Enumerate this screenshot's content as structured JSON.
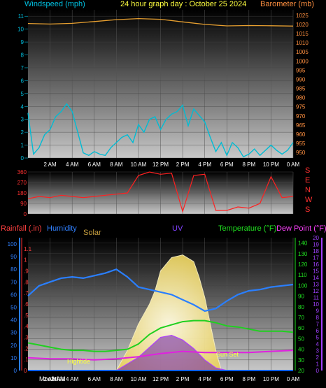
{
  "header": {
    "left": "Windspeed (mph)",
    "center": "24 hour graph day : October 25 2024",
    "right": "Barometer (mb)"
  },
  "panel3_labels": {
    "rainfall": "Rainfall (.in)",
    "humidity": "Humidity",
    "solar": "Solar",
    "uv": "UV",
    "temperature": "Temperature (°F)",
    "dewpoint": "Dew Point (°F)"
  },
  "annotations": {
    "hightide": "Hightide",
    "sunset": "Sun Set",
    "moonrise": "Moonrise",
    "time_overlap": "2 AM"
  },
  "colors": {
    "windspeed": "#00bcd4",
    "barometer": "#e8a030",
    "direction": "#ff2020",
    "humidity": "#2a7fff",
    "temperature": "#20d020",
    "dewpoint": "#e020e0",
    "uv": "#6a1aa8",
    "solar": "#f0e8a0",
    "rainfall": "#0060ff",
    "header_left": "#00c0e0",
    "header_center": "#ffff40",
    "header_right": "#ff9040"
  },
  "chart_data": [
    {
      "type": "line",
      "name": "windspeed",
      "x_ticks": [
        "2 AM",
        "4 AM",
        "6 AM",
        "8 AM",
        "10 AM",
        "12 PM",
        "2 PM",
        "4 PM",
        "6 PM",
        "8 PM",
        "10 PM",
        "0 AM"
      ],
      "left_axis": {
        "label": "Windspeed (mph)",
        "ylim": [
          0,
          11.5
        ],
        "ticks": [
          0,
          1,
          2,
          3,
          4,
          5,
          6,
          7,
          8,
          9,
          10,
          11
        ]
      },
      "right_axis": {
        "label": "Barometer (mb)",
        "ylim": [
          947,
          1028
        ],
        "ticks": [
          950,
          955,
          960,
          965,
          970,
          975,
          980,
          985,
          990,
          995,
          1000,
          1005,
          1010,
          1015,
          1020,
          1025
        ]
      },
      "series": [
        {
          "name": "Windspeed",
          "x_hours": [
            0,
            0.5,
            1,
            1.5,
            2,
            2.5,
            3,
            3.5,
            4,
            4.5,
            5,
            5.5,
            6,
            6.5,
            7,
            7.5,
            8,
            8.5,
            9,
            9.5,
            10,
            10.5,
            11,
            11.5,
            12,
            12.5,
            13,
            13.5,
            14,
            14.5,
            15,
            15.5,
            16,
            16.5,
            17,
            17.5,
            18,
            18.5,
            19,
            19.5,
            20,
            20.5,
            21,
            21.5,
            22,
            22.5,
            23,
            23.5,
            24
          ],
          "values": [
            3.5,
            0.3,
            0.8,
            1.8,
            2.2,
            3.2,
            3.6,
            4.2,
            3.6,
            2.0,
            0.4,
            0.2,
            0.5,
            0.3,
            0.2,
            0.8,
            1.2,
            1.6,
            1.8,
            1.2,
            2.6,
            2.0,
            3.0,
            3.2,
            2.2,
            3.0,
            3.4,
            3.6,
            4.1,
            2.5,
            3.8,
            3.3,
            2.8,
            1.6,
            0.5,
            1.2,
            0.2,
            1.2,
            0.8,
            0.1,
            0.3,
            0.7,
            0.2,
            0.6,
            1.0,
            0.6,
            0.3,
            0.6,
            1.2
          ]
        },
        {
          "name": "Barometer",
          "x_hours": [
            0,
            2,
            4,
            6,
            8,
            10,
            12,
            14,
            16,
            18,
            20,
            22,
            24
          ],
          "values": [
            1020.5,
            1020.2,
            1020.6,
            1021.6,
            1022.6,
            1023.2,
            1022.8,
            1021.4,
            1020.0,
            1019.2,
            1019.4,
            1019.3,
            1019.1
          ]
        }
      ]
    },
    {
      "type": "line",
      "name": "wind_direction",
      "left_axis": {
        "ylim": [
          0,
          360
        ],
        "ticks": [
          0,
          90,
          180,
          270,
          360
        ]
      },
      "right_labels": [
        "S",
        "E",
        "N",
        "W",
        "S"
      ],
      "series": [
        {
          "name": "Wind direction",
          "x_hours": [
            0,
            1,
            2,
            3,
            4,
            5,
            6,
            7,
            8,
            9,
            10,
            11,
            12,
            13,
            14,
            15,
            16,
            17,
            18,
            19,
            20,
            21,
            22,
            23,
            24
          ],
          "values": [
            130,
            150,
            140,
            160,
            150,
            140,
            150,
            160,
            170,
            180,
            330,
            360,
            340,
            350,
            20,
            330,
            340,
            30,
            30,
            60,
            50,
            90,
            320,
            140,
            150
          ]
        }
      ]
    },
    {
      "type": "line",
      "name": "weather_multi",
      "x_ticks": [
        "2 AM",
        "4 AM",
        "6 AM",
        "8 AM",
        "10 AM",
        "12 PM",
        "2 PM",
        "4 PM",
        "6 PM",
        "8 PM",
        "10 PM",
        "0 AM"
      ],
      "rain_axis": {
        "label": "Rainfall (.in)",
        "ylim": [
          0,
          1.2
        ],
        "ticks": [
          0,
          0.1,
          0.2,
          0.3,
          0.4,
          0.5,
          0.6,
          0.7,
          0.8,
          0.9,
          1.0,
          1.1
        ]
      },
      "humidity_axis": {
        "label": "Humidity",
        "ylim": [
          0,
          105
        ],
        "ticks": [
          0,
          10,
          20,
          30,
          40,
          50,
          60,
          70,
          80,
          90,
          100
        ]
      },
      "temperature_axis": {
        "label": "Temperature (°F)",
        "ylim": [
          20,
          145
        ],
        "ticks": [
          20,
          30,
          40,
          50,
          60,
          70,
          80,
          90,
          100,
          110,
          120,
          130,
          140
        ]
      },
      "uv_axis": {
        "label": "UV",
        "ylim": [
          0,
          20
        ],
        "ticks": [
          0,
          1,
          2,
          3,
          4,
          5,
          6,
          7,
          8,
          9,
          10,
          11,
          12,
          13,
          14,
          15,
          16,
          17,
          18,
          19,
          20
        ]
      },
      "series": [
        {
          "name": "Humidity",
          "x_hours": [
            0,
            1,
            2,
            3,
            4,
            5,
            6,
            7,
            8,
            9,
            10,
            11,
            12,
            13,
            14,
            15,
            16,
            17,
            18,
            19,
            20,
            21,
            22,
            23,
            24
          ],
          "values": [
            59,
            67,
            70,
            73,
            74,
            73,
            75,
            77,
            80,
            74,
            66,
            64,
            62,
            60,
            56,
            52,
            47,
            49,
            55,
            60,
            63,
            64,
            66,
            67,
            68
          ]
        },
        {
          "name": "Temperature",
          "x_hours": [
            0,
            1,
            2,
            3,
            4,
            5,
            6,
            7,
            8,
            9,
            10,
            11,
            12,
            13,
            14,
            15,
            16,
            17,
            18,
            19,
            20,
            21,
            22,
            23,
            24
          ],
          "values": [
            46,
            44,
            42,
            40,
            39,
            39,
            38,
            38,
            39,
            40,
            45,
            54,
            60,
            63,
            66,
            67,
            67,
            65,
            62,
            61,
            59,
            57,
            57,
            57,
            56
          ]
        },
        {
          "name": "Dew Point",
          "x_hours": [
            0,
            2,
            4,
            6,
            8,
            10,
            12,
            14,
            16,
            18,
            20,
            22,
            24
          ],
          "values": [
            32,
            31,
            31,
            30,
            31,
            33,
            36,
            38,
            37,
            37,
            37,
            38,
            39
          ]
        },
        {
          "name": "UV",
          "x_hours": [
            0,
            7,
            8,
            9,
            10,
            11,
            12,
            13,
            14,
            15,
            16,
            17,
            18,
            24
          ],
          "values": [
            0,
            0,
            0,
            1,
            2,
            3.5,
            5,
            5.3,
            4.6,
            3.3,
            1.6,
            0.4,
            0,
            0
          ]
        },
        {
          "name": "Solar",
          "x_hours": [
            8,
            9,
            10,
            11,
            11.5,
            12,
            13,
            14,
            15,
            15.5,
            16,
            16.5,
            17,
            17.5
          ],
          "values": [
            0,
            0.15,
            0.35,
            0.5,
            0.6,
            0.75,
            0.85,
            0.87,
            0.82,
            0.7,
            0.55,
            0.35,
            0.15,
            0
          ]
        },
        {
          "name": "Rainfall",
          "x_hours": [
            0,
            24
          ],
          "values": [
            0,
            0
          ]
        }
      ]
    }
  ]
}
